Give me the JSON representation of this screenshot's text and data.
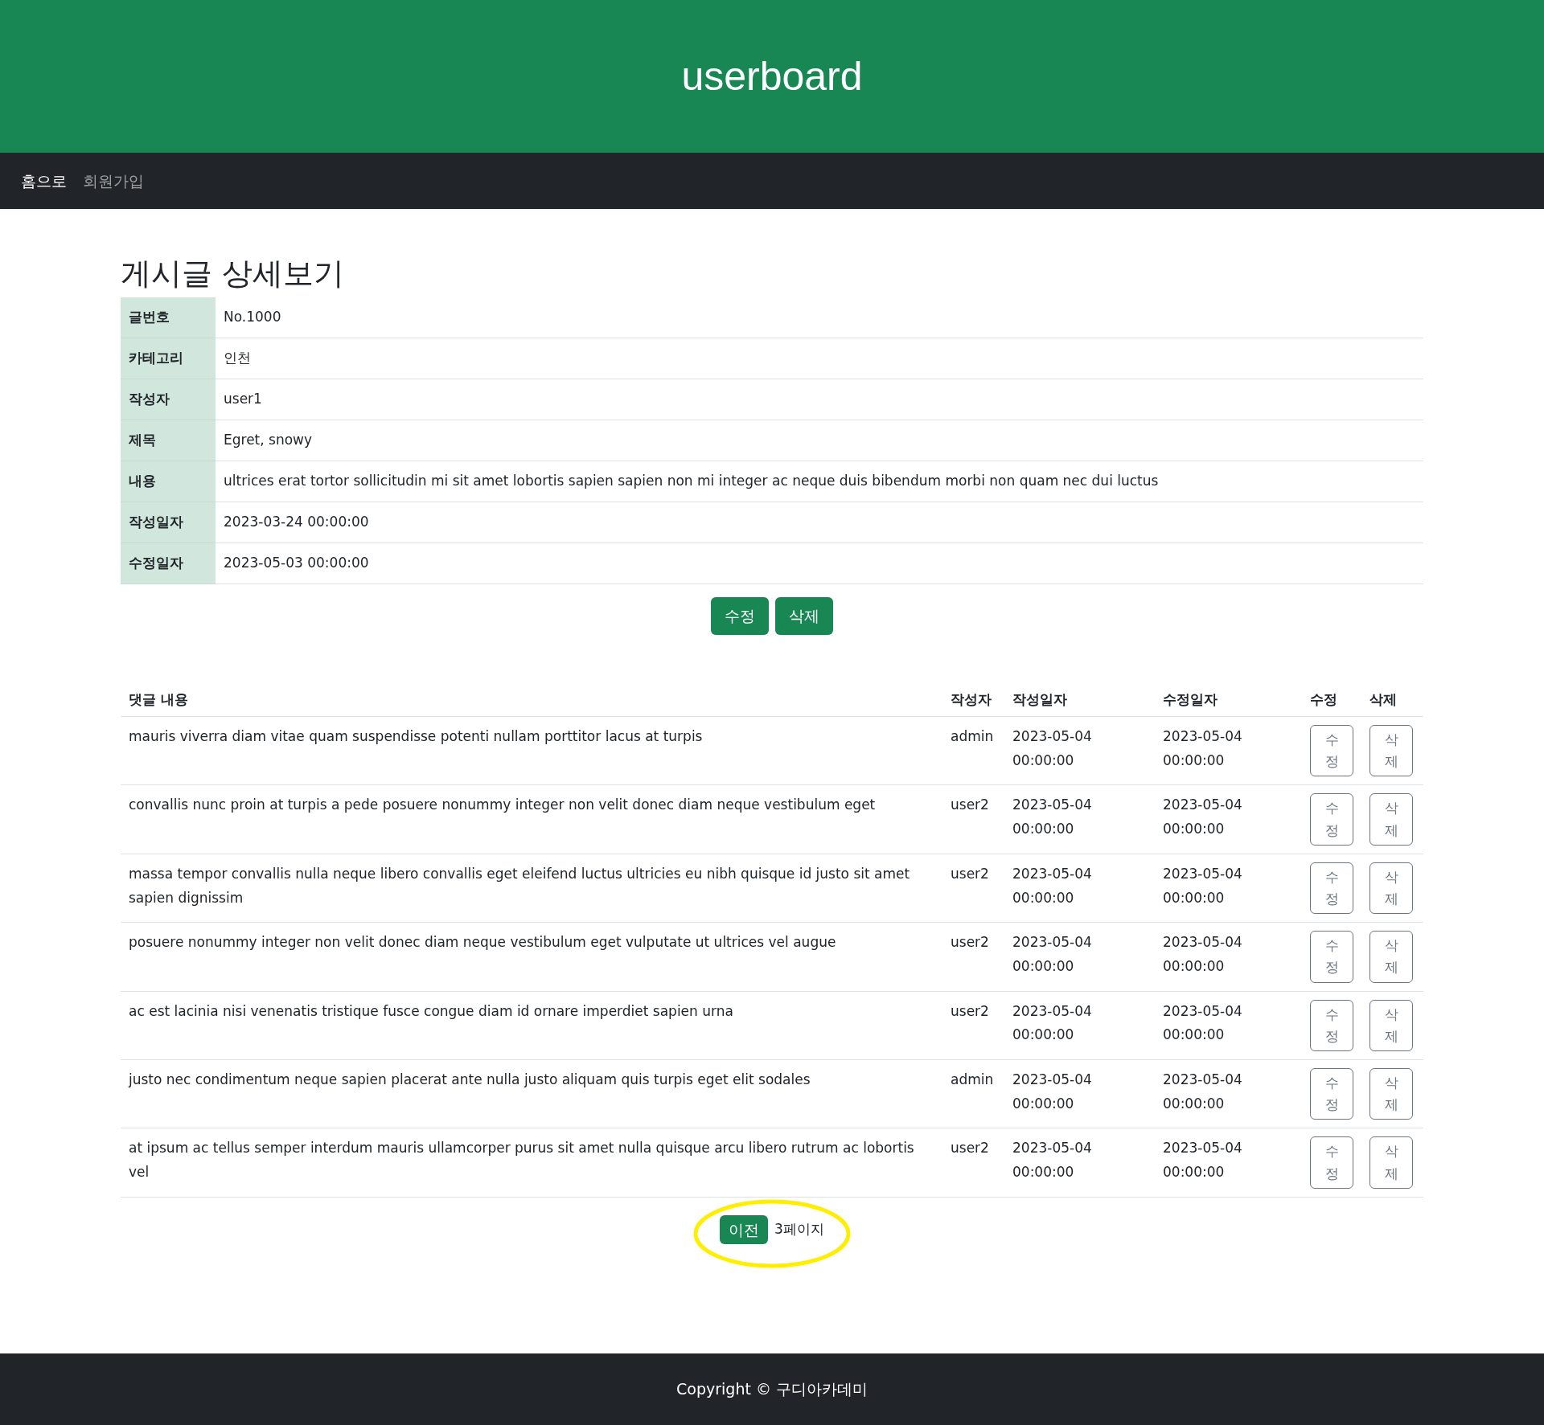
{
  "header": {
    "title": "userboard"
  },
  "nav": [
    {
      "label": "홈으로",
      "selected": true
    },
    {
      "label": "회원가입",
      "selected": false
    }
  ],
  "detail": {
    "heading": "게시글 상세보기",
    "rows": [
      {
        "label": "글번호",
        "value": "No.1000"
      },
      {
        "label": "카테고리",
        "value": "인천"
      },
      {
        "label": "작성자",
        "value": "user1"
      },
      {
        "label": "제목",
        "value": "Egret, snowy"
      },
      {
        "label": "내용",
        "value": "ultrices erat tortor sollicitudin mi sit amet lobortis sapien sapien non mi integer ac neque duis bibendum morbi non quam nec dui luctus"
      },
      {
        "label": "작성일자",
        "value": "2023-03-24 00:00:00"
      },
      {
        "label": "수정일자",
        "value": "2023-05-03 00:00:00"
      }
    ],
    "buttons": [
      "수정",
      "삭제"
    ]
  },
  "comments": {
    "columns": [
      "댓글 내용",
      "작성자",
      "작성일자",
      "수정일자",
      "수정",
      "삭제"
    ],
    "rows": [
      {
        "content": "mauris viverra diam vitae quam suspendisse potenti nullam porttitor lacus at turpis",
        "author": "admin",
        "created": "2023-05-04 00:00:00",
        "modified": "2023-05-04 00:00:00",
        "edit": "수정",
        "delete": "삭제"
      },
      {
        "content": "convallis nunc proin at turpis a pede posuere nonummy integer non velit donec diam neque vestibulum eget",
        "author": "user2",
        "created": "2023-05-04 00:00:00",
        "modified": "2023-05-04 00:00:00",
        "edit": "수정",
        "delete": "삭제"
      },
      {
        "content": "massa tempor convallis nulla neque libero convallis eget eleifend luctus ultricies eu nibh quisque id justo sit amet sapien dignissim",
        "author": "user2",
        "created": "2023-05-04 00:00:00",
        "modified": "2023-05-04 00:00:00",
        "edit": "수정",
        "delete": "삭제"
      },
      {
        "content": "posuere nonummy integer non velit donec diam neque vestibulum eget vulputate ut ultrices vel augue",
        "author": "user2",
        "created": "2023-05-04 00:00:00",
        "modified": "2023-05-04 00:00:00",
        "edit": "수정",
        "delete": "삭제"
      },
      {
        "content": "ac est lacinia nisi venenatis tristique fusce congue diam id ornare imperdiet sapien urna",
        "author": "user2",
        "created": "2023-05-04 00:00:00",
        "modified": "2023-05-04 00:00:00",
        "edit": "수정",
        "delete": "삭제"
      },
      {
        "content": "justo nec condimentum neque sapien placerat ante nulla justo aliquam quis turpis eget elit sodales",
        "author": "admin",
        "created": "2023-05-04 00:00:00",
        "modified": "2023-05-04 00:00:00",
        "edit": "수정",
        "delete": "삭제"
      },
      {
        "content": "at ipsum ac tellus semper interdum mauris ullamcorper purus sit amet nulla quisque arcu libero rutrum ac lobortis vel",
        "author": "user2",
        "created": "2023-05-04 00:00:00",
        "modified": "2023-05-04 00:00:00",
        "edit": "수정",
        "delete": "삭제"
      }
    ]
  },
  "pagination": {
    "prev": "이전",
    "page": "3페이지",
    "highlighted": true
  },
  "footer": {
    "text": "Copyright © 구디아카데미"
  }
}
